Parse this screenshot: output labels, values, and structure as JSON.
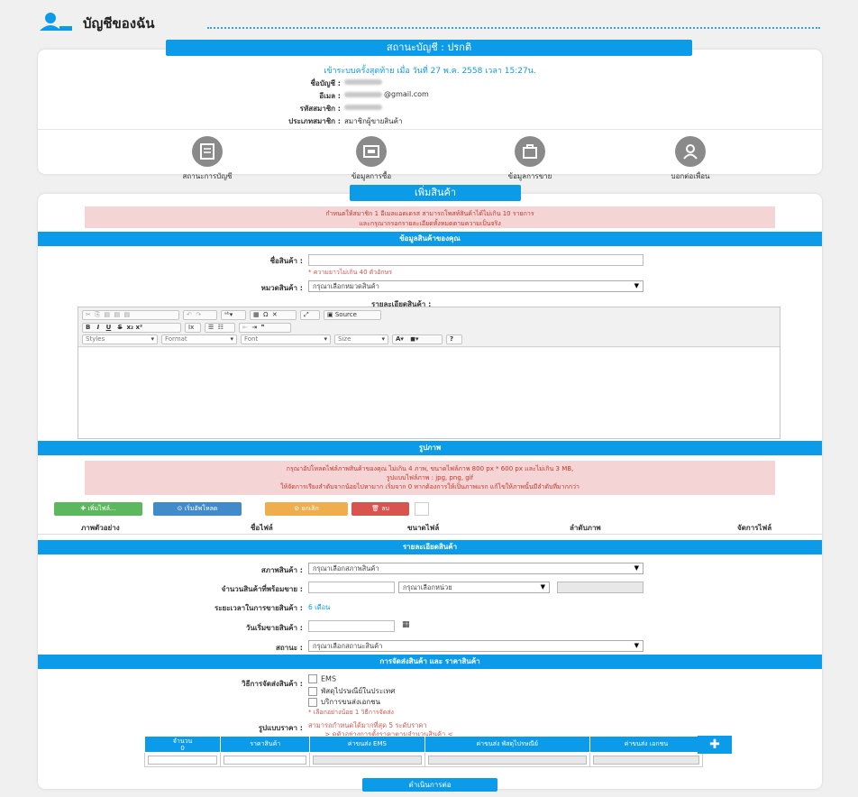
{
  "header": {
    "title": "บัญชีของฉัน"
  },
  "status_tab": "สถานะบัญชี : ปรกติ",
  "account": {
    "last_login": "เข้าระบบครั้งสุดท้าย เมื่อ วันที่ 27 พ.ค. 2558 เวลา 15:27น.",
    "rows": [
      {
        "label": "ชื่อบัญชี :",
        "value": ""
      },
      {
        "label": "อีเมล :",
        "value": "@gmail.com"
      },
      {
        "label": "รหัสสมาชิก :",
        "value": ""
      },
      {
        "label": "ประเภทสมาชิก :",
        "value": "สมาชิกผู้ขายสินค้า"
      }
    ]
  },
  "menu": [
    {
      "label": "สถานะการบัญชี",
      "icon": "account-status-icon"
    },
    {
      "label": "ข้อมูลการซื้อ",
      "icon": "purchase-info-icon"
    },
    {
      "label": "ข้อมูลการขาย",
      "icon": "sales-info-icon"
    },
    {
      "label": "บอกต่อเพื่อน",
      "icon": "tell-friends-icon"
    }
  ],
  "add_tab": "เพิ่มสินค้า",
  "alert_top": {
    "line1": "กำหนดให้สมาชิก 1 อีเมลแอดเดรส สามารถโพสท์สินค้าได้ไม่เกิน 10 รายการ",
    "line2": "และกรุณากรอกรายละเอียดทั้งหมดตามความเป็นจริง"
  },
  "section_product": "ข้อมูลสินค้าของคุณ",
  "form": {
    "product_name_label": "ชื่อสินค้า :",
    "product_name_hint": "* ความยาวไม่เกิน 40 ตัวอักษร",
    "category_label": "หมวดสินค้า :",
    "category_value": "กรุณาเลือกหมวดสินค้า",
    "details_label": "รายละเอียดสินค้า :"
  },
  "editor": {
    "source_label": "Source",
    "styles": "Styles",
    "format": "Format",
    "font": "Font",
    "size": "Size"
  },
  "section_images": "รูปภาพ",
  "alert_images": {
    "line1": "กรุณาอัปโหลดไฟล์ภาพสินค้าของคุณ ไม่เกิน 4 ภาพ, ขนาดไฟล์ภาพ 800 px * 600 px และไม่เกิน 3 MB,",
    "line2": "รูปแบบไฟล์ภาพ : jpg, png, gif",
    "line3": "ให้จัดการเรียงลำดับจากน้อยไปหามาก เริ่มจาก 0 หากต้องการให้เป็นภาพแรก แก้ไขให้ภาพนั้นมีลำดับที่มากกว่า"
  },
  "buttons": {
    "add_file": "เพิ่มไฟล์...",
    "start_upload": "เริ่มอัพโหลด",
    "cancel": "ยกเลิก",
    "delete": "ลบ"
  },
  "file_table_headers": [
    "ภาพตัวอย่าง",
    "ชื่อไฟล์",
    "ขนาดไฟล์",
    "ลำดับภาพ",
    "จัดการไฟล์"
  ],
  "section_details": "รายละเอียดสินค้า",
  "details": {
    "condition_label": "สภาพสินค้า :",
    "condition_value": "กรุณาเลือกสภาพสินค้า",
    "quantity_label": "จำนวนสินค้าที่พร้อมขาย :",
    "unit_value": "กรุณาเลือกหน่วย",
    "duration_label": "ระยะเวลาในการขายสินค้า :",
    "duration_value": "6 เดือน",
    "start_label": "วันเริ่มขายสินค้า :",
    "status_label": "สถานะ :",
    "status_value": "กรุณาเลือกสถานะสินค้า"
  },
  "section_shipping": "การจัดส่งสินค้า และ ราคาสินค้า",
  "shipping": {
    "method_label": "วิธีการจัดส่งสินค้า :",
    "options": [
      "EMS",
      "พัสดุไปรษณีย์ในประเทศ",
      "บริการขนส่งเอกชน"
    ],
    "hint": "* เลือกอย่างน้อย 1 วิธีการจัดส่ง",
    "price_format_label": "รูปแบบราคา :",
    "price_format_text": "สามารถกำหนดได้มากที่สุด 5 ระดับราคา",
    "price_format_link": "> ดูตัวอย่างการตั้งราคาตามจำนวนสินค้า <"
  },
  "price_table_headers": [
    "จำนวน",
    "ราคาสินค้า",
    "ค่าขนส่ง EMS",
    "ค่าขนส่ง พัสดุไปรษณีย์",
    "ค่าขนส่ง เอกชน"
  ],
  "price_table_qty_sub": "0",
  "submit": "ดำเนินการต่อ",
  "colors": {
    "primary": "#0b9be8",
    "danger": "#d9534f",
    "success": "#5cb85c",
    "warning": "#f0ad4e"
  }
}
